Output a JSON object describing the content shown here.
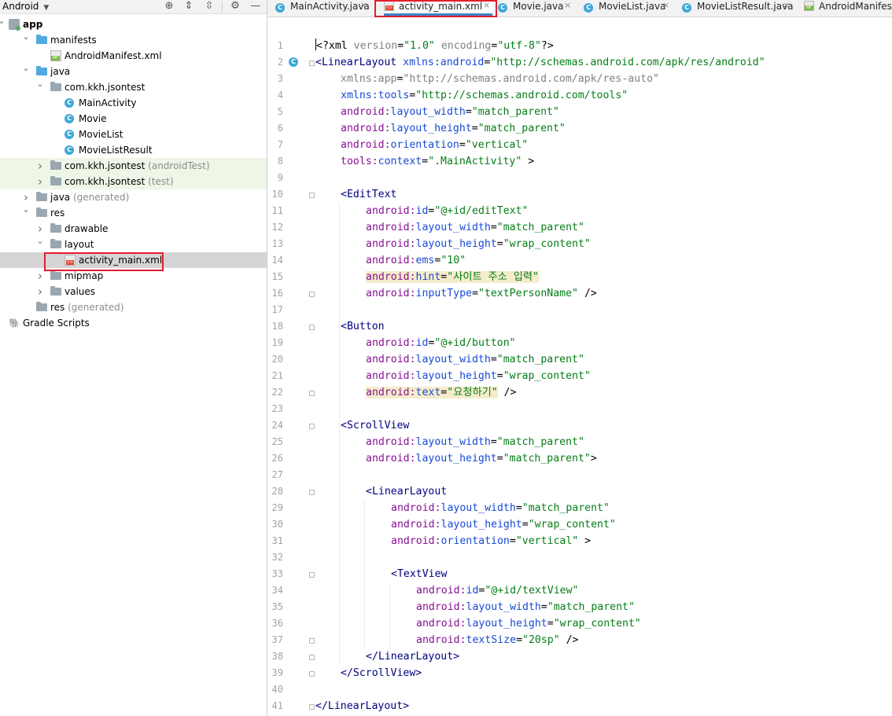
{
  "project_panel": {
    "view_mode": "Android",
    "toolbar_icons": [
      "crosshair-icon",
      "expand-all-icon",
      "collapse-all-icon",
      "gear-icon",
      "minimize-icon"
    ],
    "tree": [
      {
        "label": "app",
        "icon": "app-module-icon",
        "expanded": true,
        "depth": 0,
        "bold": true
      },
      {
        "label": "manifests",
        "icon": "folder-icon",
        "expanded": true,
        "depth": 1
      },
      {
        "label": "AndroidManifest.xml",
        "icon": "manifest-file-icon",
        "depth": 2
      },
      {
        "label": "java",
        "icon": "folder-icon",
        "expanded": true,
        "depth": 1
      },
      {
        "label": "com.kkh.jsontest",
        "icon": "package-icon",
        "expanded": true,
        "depth": 2
      },
      {
        "label": "MainActivity",
        "icon": "class-icon",
        "depth": 3
      },
      {
        "label": "Movie",
        "icon": "class-icon",
        "depth": 3
      },
      {
        "label": "MovieList",
        "icon": "class-icon",
        "depth": 3
      },
      {
        "label": "MovieListResult",
        "icon": "class-icon",
        "depth": 3
      },
      {
        "label": "com.kkh.jsontest",
        "suffix": "(androidTest)",
        "icon": "package-icon",
        "expanded": false,
        "depth": 2,
        "highlight": "green"
      },
      {
        "label": "com.kkh.jsontest",
        "suffix": "(test)",
        "icon": "package-icon",
        "expanded": false,
        "depth": 2,
        "highlight": "green"
      },
      {
        "label": "java",
        "suffix": "(generated)",
        "icon": "generated-folder-icon",
        "expanded": false,
        "depth": 1
      },
      {
        "label": "res",
        "icon": "res-folder-icon",
        "expanded": true,
        "depth": 1
      },
      {
        "label": "drawable",
        "icon": "folder-icon",
        "expanded": false,
        "depth": 2
      },
      {
        "label": "layout",
        "icon": "folder-icon",
        "expanded": true,
        "depth": 2
      },
      {
        "label": "activity_main.xml",
        "icon": "xml-layout-file-icon",
        "depth": 3,
        "selected": true
      },
      {
        "label": "mipmap",
        "icon": "folder-icon",
        "expanded": false,
        "depth": 2
      },
      {
        "label": "values",
        "icon": "folder-icon",
        "expanded": false,
        "depth": 2
      },
      {
        "label": "res",
        "suffix": "(generated)",
        "icon": "res-folder-icon",
        "depth": 1
      },
      {
        "label": "Gradle Scripts",
        "icon": "gradle-icon",
        "depth": 0
      }
    ]
  },
  "editor_tabs": [
    {
      "label": "MainActivity.java",
      "icon": "class-icon",
      "active": false
    },
    {
      "label": "activity_main.xml",
      "icon": "xml-layout-file-icon",
      "active": true
    },
    {
      "label": "Movie.java",
      "icon": "class-icon",
      "active": false
    },
    {
      "label": "MovieList.java",
      "icon": "class-icon",
      "active": false
    },
    {
      "label": "MovieListResult.java",
      "icon": "class-icon",
      "active": false
    },
    {
      "label": "AndroidManifest.xml",
      "icon": "manifest-file-icon",
      "active": false
    }
  ],
  "code_lines": [
    {
      "n": "1",
      "indent": 0,
      "tokens": [
        [
          "t",
          "<?xml "
        ],
        [
          "ag",
          "version"
        ],
        [
          "t",
          "="
        ],
        [
          "s",
          "\"1.0\""
        ],
        [
          "t",
          " "
        ],
        [
          "ag",
          "encoding"
        ],
        [
          "t",
          "="
        ],
        [
          "s",
          "\"utf-8\""
        ],
        [
          "t",
          "?>"
        ]
      ],
      "caret": true
    },
    {
      "n": "2",
      "indent": 0,
      "tokens": [
        [
          "g",
          "<LinearLayout "
        ],
        [
          "a",
          "xmlns:android"
        ],
        [
          "t",
          "="
        ],
        [
          "s",
          "\"http://schemas.android.com/apk/res/android\""
        ]
      ],
      "gutter_icon": "class-gutter-icon",
      "fold": true
    },
    {
      "n": "3",
      "indent": 1,
      "tokens": [
        [
          "ag",
          "xmlns:app"
        ],
        [
          "t",
          "="
        ],
        [
          "sg",
          "\"http://schemas.android.com/apk/res-auto\""
        ]
      ]
    },
    {
      "n": "4",
      "indent": 1,
      "tokens": [
        [
          "a",
          "xmlns:tools"
        ],
        [
          "t",
          "="
        ],
        [
          "s",
          "\"http://schemas.android.com/tools\""
        ]
      ]
    },
    {
      "n": "5",
      "indent": 1,
      "tokens": [
        [
          "ns",
          "android:"
        ],
        [
          "a",
          "layout_width"
        ],
        [
          "t",
          "="
        ],
        [
          "s",
          "\"match_parent\""
        ]
      ]
    },
    {
      "n": "6",
      "indent": 1,
      "tokens": [
        [
          "ns",
          "android:"
        ],
        [
          "a",
          "layout_height"
        ],
        [
          "t",
          "="
        ],
        [
          "s",
          "\"match_parent\""
        ]
      ]
    },
    {
      "n": "7",
      "indent": 1,
      "tokens": [
        [
          "ns",
          "android:"
        ],
        [
          "a",
          "orientation"
        ],
        [
          "t",
          "="
        ],
        [
          "s",
          "\"vertical\""
        ]
      ]
    },
    {
      "n": "8",
      "indent": 1,
      "tokens": [
        [
          "ns",
          "tools:"
        ],
        [
          "a",
          "context"
        ],
        [
          "t",
          "="
        ],
        [
          "s",
          "\".MainActivity\""
        ],
        [
          "t",
          " >"
        ]
      ]
    },
    {
      "n": "9",
      "indent": 0,
      "tokens": []
    },
    {
      "n": "10",
      "indent": 1,
      "tokens": [
        [
          "g",
          "<EditText"
        ]
      ],
      "fold": true,
      "hl_tag": true
    },
    {
      "n": "11",
      "indent": 2,
      "tokens": [
        [
          "ns",
          "android:"
        ],
        [
          "a",
          "id"
        ],
        [
          "t",
          "="
        ],
        [
          "s",
          "\"@+id/editText\""
        ]
      ]
    },
    {
      "n": "12",
      "indent": 2,
      "tokens": [
        [
          "ns",
          "android:"
        ],
        [
          "a",
          "layout_width"
        ],
        [
          "t",
          "="
        ],
        [
          "s",
          "\"match_parent\""
        ]
      ]
    },
    {
      "n": "13",
      "indent": 2,
      "tokens": [
        [
          "ns",
          "android:"
        ],
        [
          "a",
          "layout_height"
        ],
        [
          "t",
          "="
        ],
        [
          "s",
          "\"wrap_content\""
        ]
      ]
    },
    {
      "n": "14",
      "indent": 2,
      "tokens": [
        [
          "ns",
          "android:"
        ],
        [
          "a",
          "ems"
        ],
        [
          "t",
          "="
        ],
        [
          "s",
          "\"10\""
        ]
      ]
    },
    {
      "n": "15",
      "indent": 2,
      "tokens": [
        [
          "ns",
          "android:"
        ],
        [
          "a",
          "hint"
        ],
        [
          "t",
          "="
        ],
        [
          "s",
          "\"사이트 주소 입력\""
        ]
      ],
      "hl": true
    },
    {
      "n": "16",
      "indent": 2,
      "tokens": [
        [
          "ns",
          "android:"
        ],
        [
          "a",
          "inputType"
        ],
        [
          "t",
          "="
        ],
        [
          "s",
          "\"textPersonName\""
        ],
        [
          "t",
          " />"
        ]
      ],
      "fold": true
    },
    {
      "n": "17",
      "indent": 0,
      "tokens": []
    },
    {
      "n": "18",
      "indent": 1,
      "tokens": [
        [
          "g",
          "<Button"
        ]
      ],
      "fold": true
    },
    {
      "n": "19",
      "indent": 2,
      "tokens": [
        [
          "ns",
          "android:"
        ],
        [
          "a",
          "id"
        ],
        [
          "t",
          "="
        ],
        [
          "s",
          "\"@+id/button\""
        ]
      ]
    },
    {
      "n": "20",
      "indent": 2,
      "tokens": [
        [
          "ns",
          "android:"
        ],
        [
          "a",
          "layout_width"
        ],
        [
          "t",
          "="
        ],
        [
          "s",
          "\"match_parent\""
        ]
      ]
    },
    {
      "n": "21",
      "indent": 2,
      "tokens": [
        [
          "ns",
          "android:"
        ],
        [
          "a",
          "layout_height"
        ],
        [
          "t",
          "="
        ],
        [
          "s",
          "\"wrap_content\""
        ]
      ]
    },
    {
      "n": "22",
      "indent": 2,
      "tokens": [
        [
          "ns",
          "android:"
        ],
        [
          "a",
          "text"
        ],
        [
          "t",
          "="
        ],
        [
          "s",
          "\"요청하기\""
        ],
        [
          "t",
          " />"
        ]
      ],
      "hl": true,
      "fold": true
    },
    {
      "n": "23",
      "indent": 0,
      "tokens": []
    },
    {
      "n": "24",
      "indent": 1,
      "tokens": [
        [
          "g",
          "<ScrollView"
        ]
      ],
      "fold": true
    },
    {
      "n": "25",
      "indent": 2,
      "tokens": [
        [
          "ns",
          "android:"
        ],
        [
          "a",
          "layout_width"
        ],
        [
          "t",
          "="
        ],
        [
          "s",
          "\"match_parent\""
        ]
      ]
    },
    {
      "n": "26",
      "indent": 2,
      "tokens": [
        [
          "ns",
          "android:"
        ],
        [
          "a",
          "layout_height"
        ],
        [
          "t",
          "="
        ],
        [
          "s",
          "\"match_parent\""
        ],
        [
          "t",
          ">"
        ]
      ]
    },
    {
      "n": "27",
      "indent": 0,
      "tokens": []
    },
    {
      "n": "28",
      "indent": 2,
      "tokens": [
        [
          "g",
          "<LinearLayout"
        ]
      ],
      "fold": true
    },
    {
      "n": "29",
      "indent": 3,
      "tokens": [
        [
          "ns",
          "android:"
        ],
        [
          "a",
          "layout_width"
        ],
        [
          "t",
          "="
        ],
        [
          "s",
          "\"match_parent\""
        ]
      ]
    },
    {
      "n": "30",
      "indent": 3,
      "tokens": [
        [
          "ns",
          "android:"
        ],
        [
          "a",
          "layout_height"
        ],
        [
          "t",
          "="
        ],
        [
          "s",
          "\"wrap_content\""
        ]
      ]
    },
    {
      "n": "31",
      "indent": 3,
      "tokens": [
        [
          "ns",
          "android:"
        ],
        [
          "a",
          "orientation"
        ],
        [
          "t",
          "="
        ],
        [
          "s",
          "\"vertical\""
        ],
        [
          "t",
          " >"
        ]
      ]
    },
    {
      "n": "32",
      "indent": 0,
      "tokens": []
    },
    {
      "n": "33",
      "indent": 3,
      "tokens": [
        [
          "g",
          "<TextView"
        ]
      ],
      "fold": true
    },
    {
      "n": "34",
      "indent": 4,
      "tokens": [
        [
          "ns",
          "android:"
        ],
        [
          "a",
          "id"
        ],
        [
          "t",
          "="
        ],
        [
          "s",
          "\"@+id/textView\""
        ]
      ]
    },
    {
      "n": "35",
      "indent": 4,
      "tokens": [
        [
          "ns",
          "android:"
        ],
        [
          "a",
          "layout_width"
        ],
        [
          "t",
          "="
        ],
        [
          "s",
          "\"match_parent\""
        ]
      ]
    },
    {
      "n": "36",
      "indent": 4,
      "tokens": [
        [
          "ns",
          "android:"
        ],
        [
          "a",
          "layout_height"
        ],
        [
          "t",
          "="
        ],
        [
          "s",
          "\"wrap_content\""
        ]
      ]
    },
    {
      "n": "37",
      "indent": 4,
      "tokens": [
        [
          "ns",
          "android:"
        ],
        [
          "a",
          "textSize"
        ],
        [
          "t",
          "="
        ],
        [
          "s",
          "\"20sp\""
        ],
        [
          "t",
          " />"
        ]
      ],
      "fold": true
    },
    {
      "n": "38",
      "indent": 2,
      "tokens": [
        [
          "g",
          "</LinearLayout>"
        ]
      ],
      "fold": true
    },
    {
      "n": "39",
      "indent": 1,
      "tokens": [
        [
          "g",
          "</ScrollView>"
        ]
      ],
      "fold": true
    },
    {
      "n": "40",
      "indent": 0,
      "tokens": []
    },
    {
      "n": "41",
      "indent": 0,
      "tokens": [
        [
          "g",
          "</LinearLayout>"
        ]
      ],
      "fold": true
    }
  ],
  "colors": {
    "selection_box": "#e01e2e",
    "active_tab_underline": "#4083c9",
    "tag": "#000080",
    "namespace": "#871094",
    "attribute": "#174ad4",
    "string": "#067d17",
    "highlight_line": "#f5eccb",
    "test_package_bg": "#eef6e7"
  }
}
